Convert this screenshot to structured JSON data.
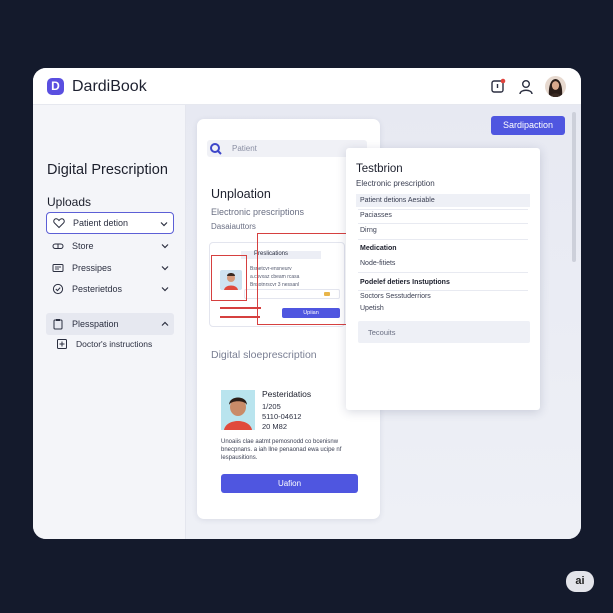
{
  "app": {
    "logo_letter": "D",
    "title": "DardiBook"
  },
  "header": {
    "icons": [
      "notification-icon",
      "user-icon",
      "avatar"
    ],
    "notification_color": "#e0443e"
  },
  "sidebar": {
    "page_title": "Digital Prescription",
    "section_title": "Uploads",
    "items": [
      {
        "label": "Patient detion",
        "icon": "heart-icon",
        "state": "active"
      },
      {
        "label": "Store",
        "icon": "pill-icon"
      },
      {
        "label": "Pressipes",
        "icon": "card-icon"
      },
      {
        "label": "Pesterietdos",
        "icon": "check-circle-icon"
      },
      {
        "label": "Plesspation",
        "icon": "clipboard-icon",
        "state": "expanded"
      },
      {
        "label": "Doctor's instructions",
        "icon": "plus-square-icon"
      }
    ]
  },
  "toolbar": {
    "primary_button": "Sardipaction"
  },
  "card_left": {
    "search_placeholder": "Patient",
    "title": "Unploation",
    "subtitle": "Electronic prescriptions",
    "subtitle2": "Dasaiauttors",
    "preview": {
      "title": "Preslications",
      "lines": [
        "Bsnetcvr-ensneurv",
        "a.csvxaz cbeam rcasa",
        "Bnsotnrscvr 3 nessanl"
      ],
      "button": "Upiian"
    },
    "section_label": "Digital sloeprescription",
    "patient": {
      "name": "Pesteridatios",
      "meta": [
        "1/205",
        "5110-04612",
        "20 M82"
      ],
      "description": "Unoaiis clae aatmt pemosnodd co bcenisnw bnecpnans. a iah llne penaonad ewa ucipe nf lespausitions.",
      "button": "Uafion"
    }
  },
  "card_right": {
    "title": "Testbrion",
    "subtitle": "Electronic prescription",
    "rows": [
      {
        "label": "Patient detions Aesiable",
        "bold": false
      },
      {
        "label": "Paciasses",
        "bold": false
      },
      {
        "label": "Dirng",
        "bold": false
      },
      {
        "label": "Medication",
        "bold": true
      },
      {
        "label": "Node-fitiets",
        "bold": false
      },
      {
        "label": "Podelef detiers Instuptions",
        "bold": true
      },
      {
        "label": "Soctors Sesstuderriors",
        "bold": false
      },
      {
        "label": "Upetish",
        "bold": false
      }
    ],
    "input_placeholder": "Tecouits"
  },
  "badge": "ai",
  "colors": {
    "accent": "#4f56e0",
    "highlight": "#d6403f",
    "background": "#141a2c"
  }
}
